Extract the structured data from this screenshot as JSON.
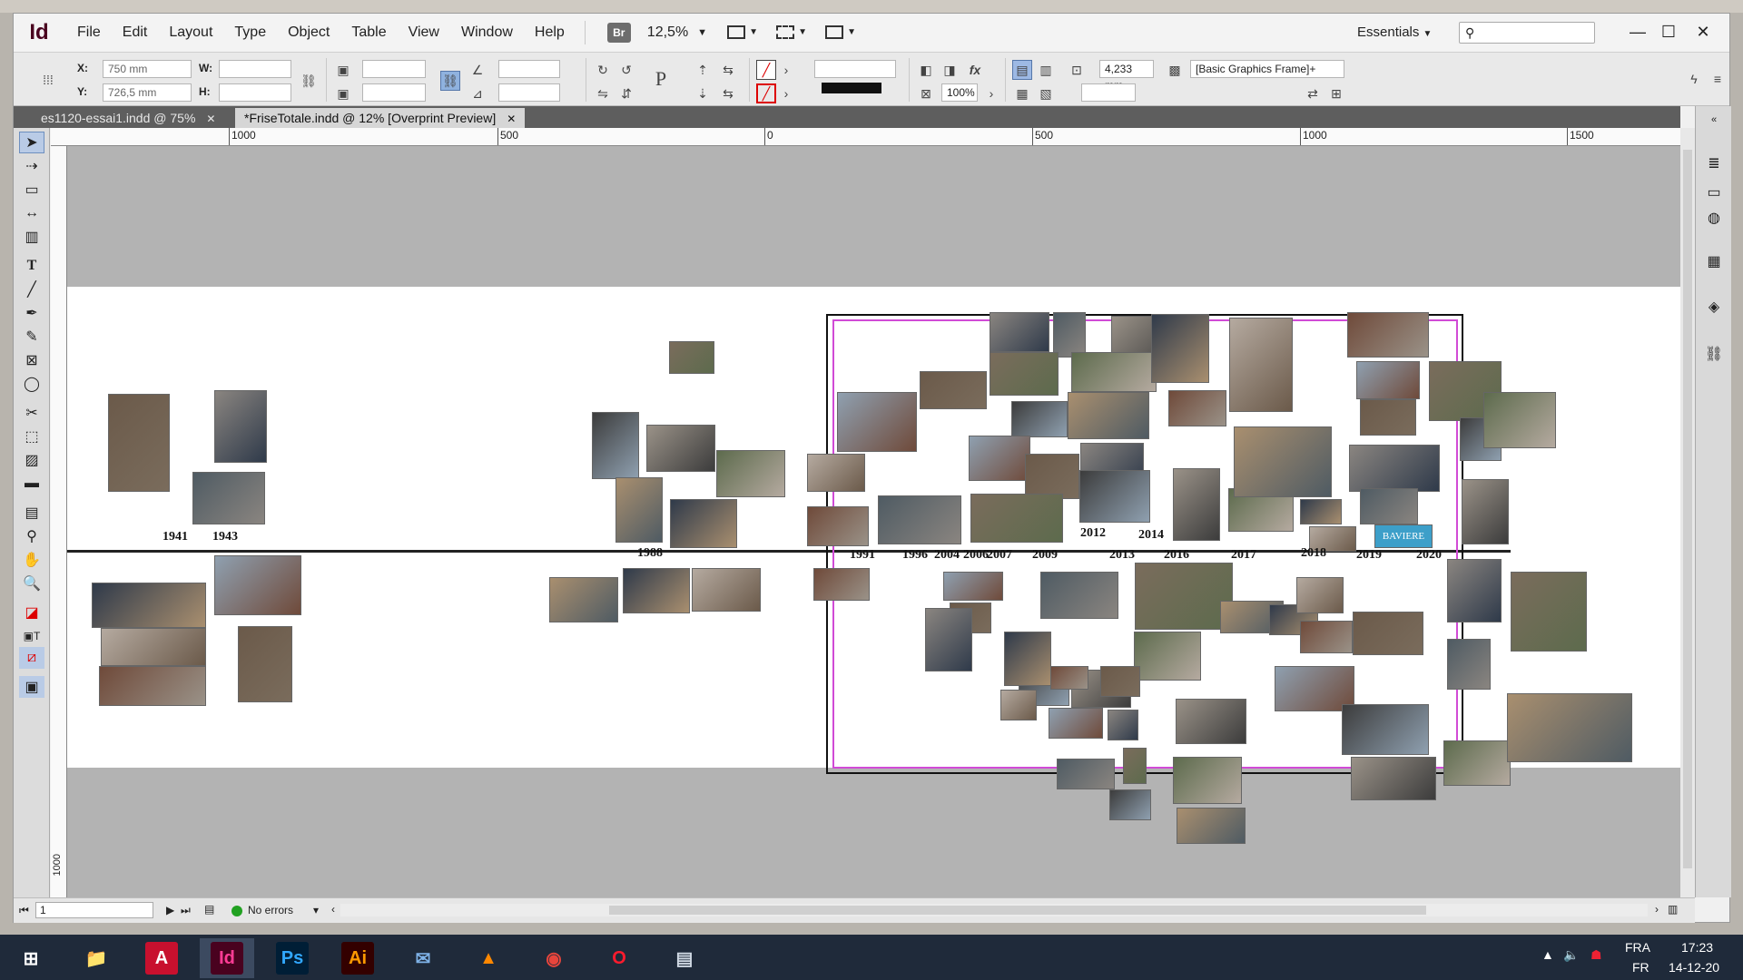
{
  "app": {
    "logo": "Id",
    "menus": [
      "File",
      "Edit",
      "Layout",
      "Type",
      "Object",
      "Table",
      "View",
      "Window",
      "Help"
    ],
    "bridge": "Br",
    "zoom": "12,5%",
    "workspace": "Essentials",
    "window_controls": [
      "—",
      "☐",
      "✕"
    ]
  },
  "control_panel": {
    "x_label": "X:",
    "x_value": "750 mm",
    "y_label": "Y:",
    "y_value": "726,5 mm",
    "w_label": "W:",
    "h_label": "H:",
    "stroke_weight": "4,233 mm",
    "opacity": "100%",
    "object_style": "[Basic Graphics Frame]+"
  },
  "tabs": [
    {
      "label": "es1120-essai1.indd @ 75%",
      "active": false
    },
    {
      "label": "*FriseTotale.indd @ 12% [Overprint Preview]",
      "active": true
    }
  ],
  "ruler": {
    "labels": [
      "1000",
      "500",
      "0",
      "500",
      "1000",
      "1500"
    ],
    "v_labels": [
      "1000"
    ]
  },
  "canvas": {
    "years_top": [
      "1941",
      "1943",
      "1988",
      "1991",
      "1996",
      "2004",
      "2006",
      "2007",
      "2009",
      "2012",
      "2013",
      "2014",
      "2016",
      "2017",
      "2018",
      "2019",
      "2020"
    ],
    "logo_text": "BAVIERE"
  },
  "status": {
    "page": "1",
    "preflight": "No errors"
  },
  "taskbar": {
    "apps": [
      {
        "name": "windows-start",
        "label": "⊞",
        "color": "#ffffff",
        "bg": "transparent"
      },
      {
        "name": "file-explorer",
        "label": "📁",
        "color": "#f2c84b",
        "bg": "transparent"
      },
      {
        "name": "acrobat",
        "label": "A",
        "color": "#ffffff",
        "bg": "#c8102e"
      },
      {
        "name": "indesign",
        "label": "Id",
        "color": "#ff3c95",
        "bg": "#49021f"
      },
      {
        "name": "photoshop",
        "label": "Ps",
        "color": "#31a8ff",
        "bg": "#001e36"
      },
      {
        "name": "illustrator",
        "label": "Ai",
        "color": "#ff9a00",
        "bg": "#330000"
      },
      {
        "name": "thunderbird",
        "label": "✉",
        "color": "#7fb3e8",
        "bg": "transparent"
      },
      {
        "name": "vlc",
        "label": "▲",
        "color": "#ff8800",
        "bg": "transparent"
      },
      {
        "name": "chrome",
        "label": "◉",
        "color": "#e8453c",
        "bg": "transparent"
      },
      {
        "name": "opera",
        "label": "O",
        "color": "#ff1b2d",
        "bg": "transparent"
      },
      {
        "name": "notes",
        "label": "▤",
        "color": "#cfd8e3",
        "bg": "transparent"
      }
    ],
    "lang": "FRA",
    "lang2": "FR",
    "time": "17:23",
    "date": "14-12-20"
  }
}
